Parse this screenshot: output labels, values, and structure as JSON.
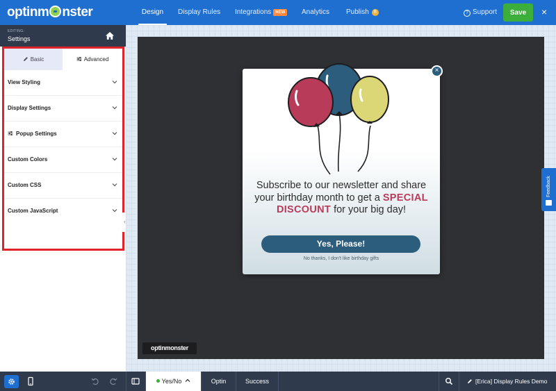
{
  "app": {
    "logo_prefix": "optinm",
    "logo_suffix": "nster"
  },
  "nav": {
    "tabs": [
      {
        "label": "Design"
      },
      {
        "label": "Display Rules"
      },
      {
        "label": "Integrations",
        "badge": "NEW"
      },
      {
        "label": "Analytics"
      },
      {
        "label": "Publish",
        "badge": "8"
      }
    ],
    "active_tab": "Design",
    "support_label": "Support",
    "save_label": "Save",
    "close_icon": "×"
  },
  "sidebar": {
    "editing_label": "EDITING:",
    "editing_value": "Settings",
    "tabs": [
      {
        "label": "Basic",
        "icon": "pencil-icon"
      },
      {
        "label": "Advanced",
        "icon": "sliders-icon"
      }
    ],
    "active_tab": "Basic",
    "items": [
      {
        "label": "View Styling"
      },
      {
        "label": "Display Settings"
      },
      {
        "label": "Popup Settings",
        "icon": "sliders-icon"
      },
      {
        "label": "Custom Colors"
      },
      {
        "label": "Custom CSS"
      },
      {
        "label": "Custom JavaScript"
      }
    ]
  },
  "popup": {
    "headline_part1": "Subscribe to our newsletter and share your birthday month to get a ",
    "headline_highlight": "SPECIAL DISCOUNT",
    "headline_part2": " for your big day!",
    "yes_button": "Yes, Please!",
    "no_link": "No thanks, I don't like birthday gifts",
    "close_icon": "×",
    "watermark": "optinmonster"
  },
  "feedback": {
    "label": "Feedback"
  },
  "bottom": {
    "tabs": [
      {
        "label": "Yes/No",
        "status": "active"
      },
      {
        "label": "Optin"
      },
      {
        "label": "Success"
      }
    ],
    "campaign_title": "[Erica] Display Rules Demo"
  },
  "colors": {
    "brand_blue": "#1f6fd1",
    "save_green": "#3bae3b",
    "sidebar_dark": "#2f3b4c",
    "highlight_red": "#e0232a",
    "popup_button": "#2d5d7d",
    "discount_red": "#b83c5a"
  }
}
